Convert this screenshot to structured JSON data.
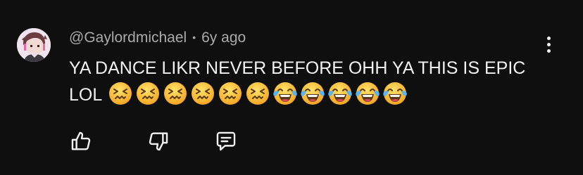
{
  "comment": {
    "author": "@Gaylordmichael",
    "separator": "•",
    "timestamp": "6y ago",
    "text": "YA DANCE LIKR NEVER BEFORE OHH YA THIS IS EPIC LOL",
    "emojis": [
      "confounded-face",
      "confounded-face",
      "confounded-face",
      "confounded-face",
      "confounded-face",
      "confounded-face",
      "face-with-tears-of-joy",
      "face-with-tears-of-joy",
      "face-with-tears-of-joy",
      "face-with-tears-of-joy",
      "face-with-tears-of-joy"
    ]
  },
  "actions": {
    "like_icon": "thumbs-up-icon",
    "dislike_icon": "thumbs-down-icon",
    "reply_icon": "comment-icon",
    "menu_icon": "more-vertical-icon"
  },
  "colors": {
    "background": "#0f0f0f",
    "primary_text": "#f1f1f1",
    "secondary_text": "#aaaaaa"
  }
}
